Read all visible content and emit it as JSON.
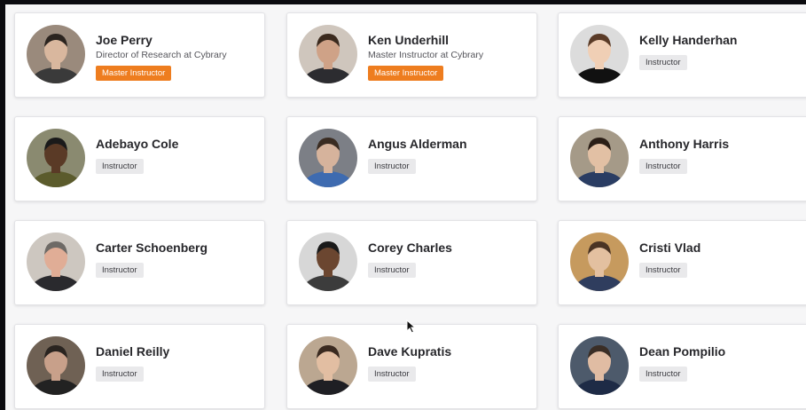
{
  "instructors": [
    {
      "name": "Joe Perry",
      "title": "Director of Research at Cybrary",
      "badge": "Master Instructor",
      "badge_type": "master",
      "bg": "#9a8a7c",
      "skin": "#d9b79e",
      "shirt": "#3a3a3a",
      "hair": "#2b241f"
    },
    {
      "name": "Ken Underhill",
      "title": "Master Instructor at Cybrary",
      "badge": "Master Instructor",
      "badge_type": "master",
      "bg": "#cfc6bd",
      "skin": "#cfa287",
      "shirt": "#2c2c30",
      "hair": "#3b2a1e"
    },
    {
      "name": "Kelly Handerhan",
      "title": "",
      "badge": "Instructor",
      "badge_type": "plain",
      "bg": "#dcdcdc",
      "skin": "#f0cfb5",
      "shirt": "#111111",
      "hair": "#5a3b27"
    },
    {
      "name": "Adebayo Cole",
      "title": "",
      "badge": "Instructor",
      "badge_type": "plain",
      "bg": "#8a8a70",
      "skin": "#5a3a26",
      "shirt": "#5b5b2c",
      "hair": "#1a1a1a"
    },
    {
      "name": "Angus Alderman",
      "title": "",
      "badge": "Instructor",
      "badge_type": "plain",
      "bg": "#7c7f86",
      "skin": "#d6b39c",
      "shirt": "#3e6bb0",
      "hair": "#3a2c22"
    },
    {
      "name": "Anthony Harris",
      "title": "",
      "badge": "Instructor",
      "badge_type": "plain",
      "bg": "#a59a88",
      "skin": "#e2c0a4",
      "shirt": "#2a3d63",
      "hair": "#2b1e16"
    },
    {
      "name": "Carter Schoenberg",
      "title": "",
      "badge": "Instructor",
      "badge_type": "plain",
      "bg": "#cdc7c0",
      "skin": "#e0ad96",
      "shirt": "#2a2a2e",
      "hair": "#6e6a66"
    },
    {
      "name": "Corey Charles",
      "title": "",
      "badge": "Instructor",
      "badge_type": "plain",
      "bg": "#d7d7d7",
      "skin": "#6b4630",
      "shirt": "#3c3c3c",
      "hair": "#1a1a1a"
    },
    {
      "name": "Cristi Vlad",
      "title": "",
      "badge": "Instructor",
      "badge_type": "plain",
      "bg": "#c69a5e",
      "skin": "#e3c0a0",
      "shirt": "#2f3d5e",
      "hair": "#4a3424"
    },
    {
      "name": "Daniel Reilly",
      "title": "",
      "badge": "Instructor",
      "badge_type": "plain",
      "bg": "#6f6154",
      "skin": "#c8a08a",
      "shirt": "#222222",
      "hair": "#2a2420"
    },
    {
      "name": "Dave Kupratis",
      "title": "",
      "badge": "Instructor",
      "badge_type": "plain",
      "bg": "#bba791",
      "skin": "#e2bea2",
      "shirt": "#1f1f24",
      "hair": "#3a2a20"
    },
    {
      "name": "Dean Pompilio",
      "title": "",
      "badge": "Instructor",
      "badge_type": "plain",
      "bg": "#4d5a6b",
      "skin": "#e0bca3",
      "shirt": "#1e2b46",
      "hair": "#3a2e26"
    }
  ]
}
